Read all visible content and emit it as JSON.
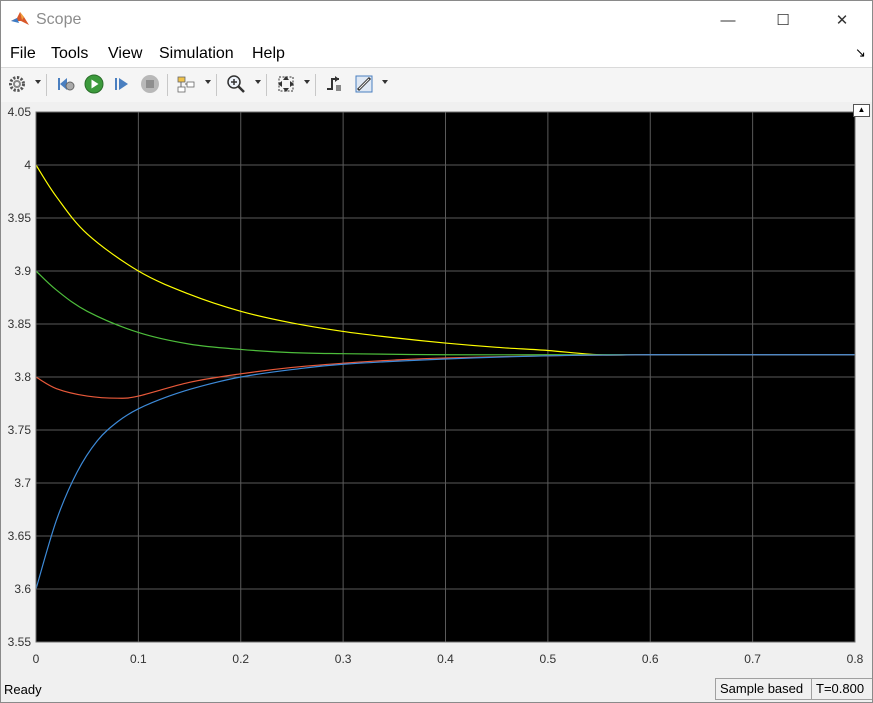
{
  "window": {
    "title": "Scope",
    "controls": {
      "minimize": "—",
      "maximize": "☐",
      "close": "✕"
    }
  },
  "menu": {
    "items": [
      "File",
      "Tools",
      "View",
      "Simulation",
      "Help"
    ]
  },
  "toolbar": {
    "icons": [
      "gear-icon",
      "step-back-icon",
      "run-icon",
      "step-forward-icon",
      "stop-icon",
      "highlight-model-icon",
      "zoom-in-icon",
      "fit-to-view-icon",
      "triggers-icon",
      "cursor-measure-icon"
    ]
  },
  "plot": {
    "background": "#000000",
    "grid_color": "#5a5a5a"
  },
  "chart_data": {
    "type": "line",
    "xlim": [
      0,
      0.8
    ],
    "ylim": [
      3.55,
      4.05
    ],
    "xticks": [
      "0",
      "0.1",
      "0.2",
      "0.3",
      "0.4",
      "0.5",
      "0.6",
      "0.7",
      "0.8"
    ],
    "yticks": [
      "3.55",
      "3.6",
      "3.65",
      "3.7",
      "3.75",
      "3.8",
      "3.85",
      "3.9",
      "3.95",
      "4",
      "4.05"
    ],
    "grid": true,
    "series": [
      {
        "color": "#ffff00",
        "x": [
          0,
          0.02,
          0.05,
          0.1,
          0.15,
          0.2,
          0.25,
          0.3,
          0.35,
          0.4,
          0.45,
          0.5,
          0.55,
          0.6,
          0.7,
          0.8
        ],
        "y": [
          4.0,
          3.97,
          3.935,
          3.9,
          3.878,
          3.862,
          3.851,
          3.843,
          3.837,
          3.832,
          3.828,
          3.825,
          3.821,
          3.821,
          3.821,
          3.821
        ]
      },
      {
        "color": "#4dbd3b",
        "x": [
          0,
          0.02,
          0.05,
          0.1,
          0.15,
          0.2,
          0.25,
          0.3,
          0.4,
          0.5,
          0.6,
          0.7,
          0.8
        ],
        "y": [
          3.9,
          3.882,
          3.862,
          3.842,
          3.831,
          3.826,
          3.823,
          3.822,
          3.821,
          3.821,
          3.821,
          3.821,
          3.821
        ]
      },
      {
        "color": "#e8593a",
        "x": [
          0,
          0.02,
          0.05,
          0.08,
          0.1,
          0.15,
          0.2,
          0.25,
          0.3,
          0.35,
          0.4,
          0.5,
          0.6,
          0.7,
          0.8
        ],
        "y": [
          3.8,
          3.789,
          3.782,
          3.78,
          3.782,
          3.795,
          3.803,
          3.809,
          3.813,
          3.816,
          3.818,
          3.82,
          3.821,
          3.821,
          3.821
        ]
      },
      {
        "color": "#3d8ad8",
        "x": [
          0,
          0.02,
          0.04,
          0.06,
          0.08,
          0.1,
          0.13,
          0.16,
          0.2,
          0.25,
          0.3,
          0.4,
          0.5,
          0.6,
          0.7,
          0.8
        ],
        "y": [
          3.6,
          3.665,
          3.71,
          3.74,
          3.758,
          3.77,
          3.782,
          3.791,
          3.8,
          3.807,
          3.812,
          3.817,
          3.82,
          3.821,
          3.821,
          3.821
        ]
      }
    ]
  },
  "status": {
    "text": "Ready",
    "sample_mode": "Sample based",
    "time": "T=0.800"
  }
}
